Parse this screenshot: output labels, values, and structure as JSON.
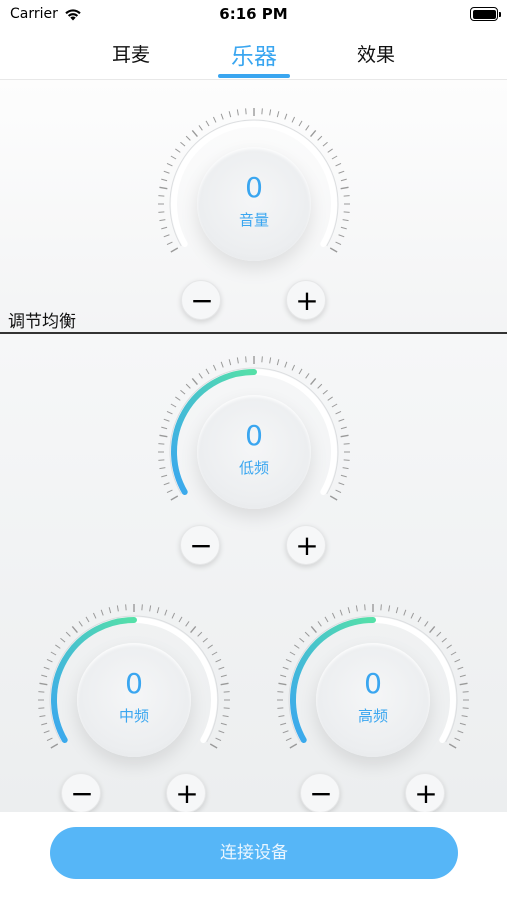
{
  "status_bar": {
    "carrier": "Carrier",
    "time": "6:16 PM"
  },
  "tabs": [
    {
      "label": "耳麦",
      "active": false
    },
    {
      "label": "乐器",
      "active": true
    },
    {
      "label": "效果",
      "active": false
    }
  ],
  "volume": {
    "value": "0",
    "label": "音量",
    "level": 0
  },
  "section": {
    "title": "调节均衡"
  },
  "eq": {
    "bass": {
      "value": "0",
      "label": "低频",
      "level": 0
    },
    "middle": {
      "value": "0",
      "label": "中频",
      "level": 0
    },
    "treble": {
      "value": "0",
      "label": "高频",
      "level": 0
    }
  },
  "controls": {
    "minus": "−",
    "plus": "+"
  },
  "connect_button": {
    "label": "连接设备"
  },
  "colors": {
    "accent": "#3aa6f0",
    "arc_start": "#3aa6f0",
    "arc_end": "#55e0a8",
    "button": "#56b6f7"
  }
}
